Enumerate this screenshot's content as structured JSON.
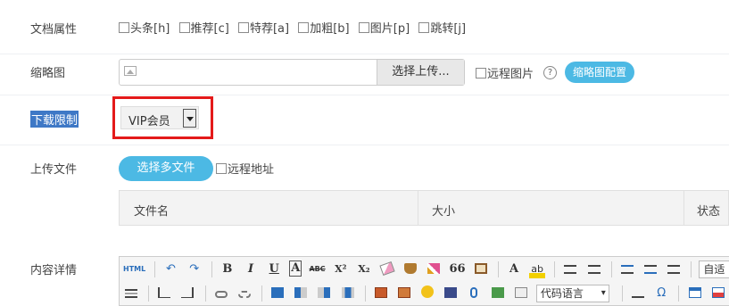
{
  "doc_attr": {
    "label": "文档属性",
    "options": [
      "头条[h]",
      "推荐[c]",
      "特荐[a]",
      "加粗[b]",
      "图片[p]",
      "跳转[j]"
    ]
  },
  "thumbnail": {
    "label": "缩略图",
    "upload_label": "选择上传...",
    "remote_label": "远程图片",
    "help_symbol": "?",
    "config_label": "缩略图配置"
  },
  "download": {
    "label": "下载限制",
    "selected": "VIP会员"
  },
  "upload": {
    "label": "上传文件",
    "multi_label": "选择多文件",
    "remote_label": "远程地址",
    "columns": [
      "文件名",
      "大小",
      "状态"
    ]
  },
  "content": {
    "label": "内容详情",
    "toolbar_row1": [
      "HTML",
      "↶",
      "↷",
      "B",
      "I",
      "U",
      "A",
      "ABC",
      "X²",
      "X₂"
    ],
    "toolbar_row1_extra": [
      "66",
      "A",
      "ab",
      "自适"
    ],
    "code_lang": "代码语言",
    "toolbar_row2_text": [
      "Ω"
    ]
  },
  "colors": {
    "accent": "#4cb9e4",
    "highlight_border": "#e41a1a",
    "label_selected_bg": "#3e78c6"
  }
}
